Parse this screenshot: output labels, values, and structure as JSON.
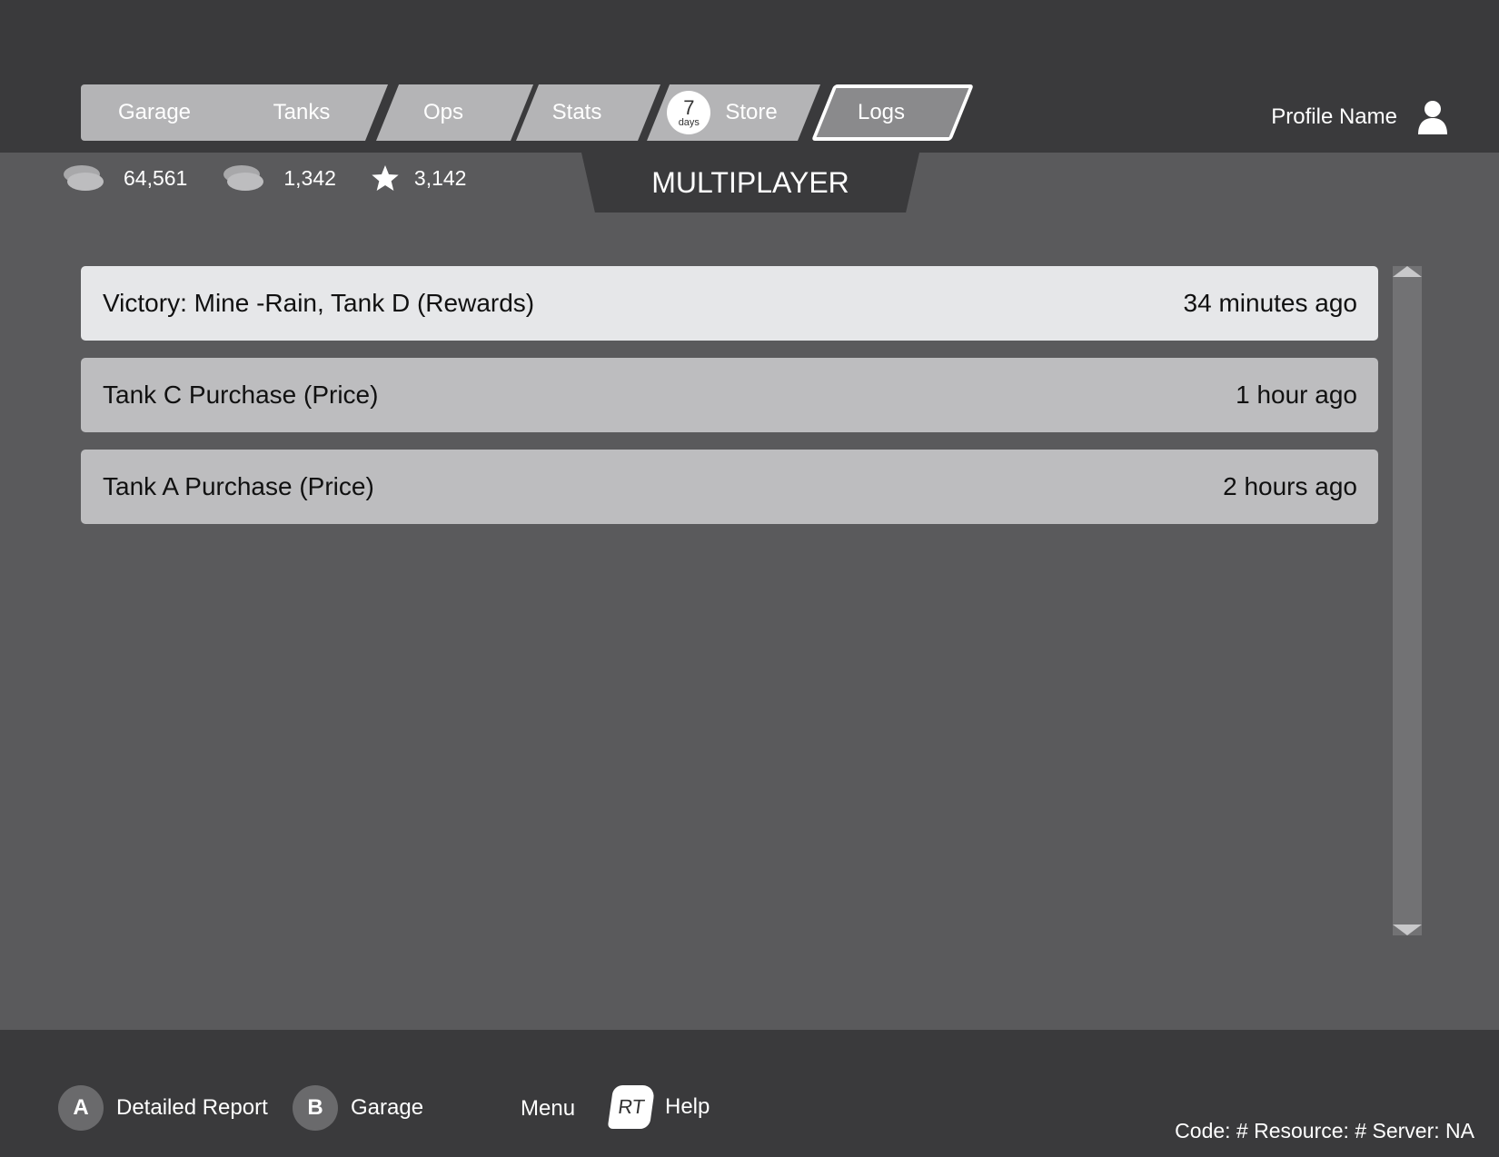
{
  "tabs": [
    {
      "label": "Garage"
    },
    {
      "label": "Tanks"
    },
    {
      "label": "Ops"
    },
    {
      "label": "Stats"
    },
    {
      "label": "Store",
      "badge_number": "7",
      "badge_unit": "days"
    },
    {
      "label": "Logs",
      "active": true
    }
  ],
  "profile": {
    "name": "Profile Name",
    "icon": "user-icon"
  },
  "currencies": [
    {
      "icon": "coin-stack-icon",
      "value": "64,561"
    },
    {
      "icon": "coin-stack-icon",
      "value": "1,342"
    },
    {
      "icon": "star-icon",
      "value": "3,142"
    }
  ],
  "mode_title": "MULTIPLAYER",
  "logs": [
    {
      "text": "Victory: Mine -Rain, Tank D (Rewards)",
      "time": "34 minutes ago",
      "selected": true
    },
    {
      "text": "Tank C Purchase (Price)",
      "time": "1 hour ago"
    },
    {
      "text": "Tank A Purchase (Price)",
      "time": "2 hours ago"
    }
  ],
  "hints": [
    {
      "button": "A",
      "label": "Detailed Report"
    },
    {
      "button": "B",
      "label": "Garage"
    },
    {
      "button": "",
      "label": "Menu"
    },
    {
      "button": "RT",
      "label": "Help"
    }
  ],
  "footer": {
    "info": "Code: # Resource: # Server: NA"
  },
  "colors": {
    "topbar": "#3a3a3c",
    "background": "#5a5a5c",
    "tab": "#b4b4b6",
    "row": "#bdbdbf",
    "row_selected": "#e6e7e9"
  }
}
